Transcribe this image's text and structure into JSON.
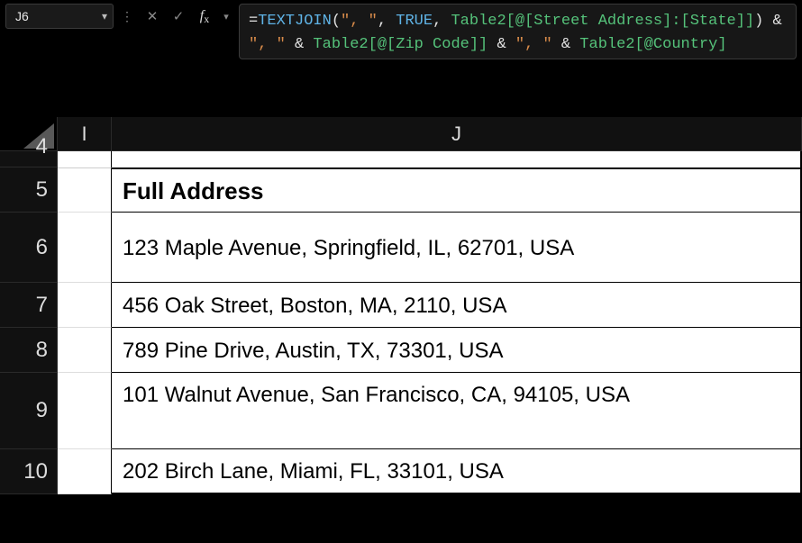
{
  "namebox": {
    "value": "J6"
  },
  "formula_tokens": {
    "fn": "TEXTJOIN",
    "eq": "=",
    "open": "(",
    "arg1": "\", \"",
    "comma": ", ",
    "arg2": "TRUE",
    "arg3": "Table2[@[Street Address]:[State]]",
    "close": ")",
    "amp": " & ",
    "str2": "\", \"",
    "tbl2": "Table2[@[Zip Code]]",
    "tbl3": "Table2[@Country]"
  },
  "columns": {
    "I": "I",
    "J": "J"
  },
  "rows": {
    "r4": "4",
    "r5": "5",
    "r6": "6",
    "r7": "7",
    "r8": "8",
    "r9": "9",
    "r10": "10"
  },
  "cells": {
    "header": "Full Address",
    "r6": "123 Maple Avenue, Springfield, IL, 62701, USA",
    "r7": "456 Oak Street, Boston, MA, 2110, USA",
    "r8": "789 Pine Drive, Austin, TX, 73301, USA",
    "r9": "101 Walnut Avenue, San Francisco, CA, 94105, USA",
    "r10": "202 Birch Lane, Miami, FL, 33101, USA"
  }
}
